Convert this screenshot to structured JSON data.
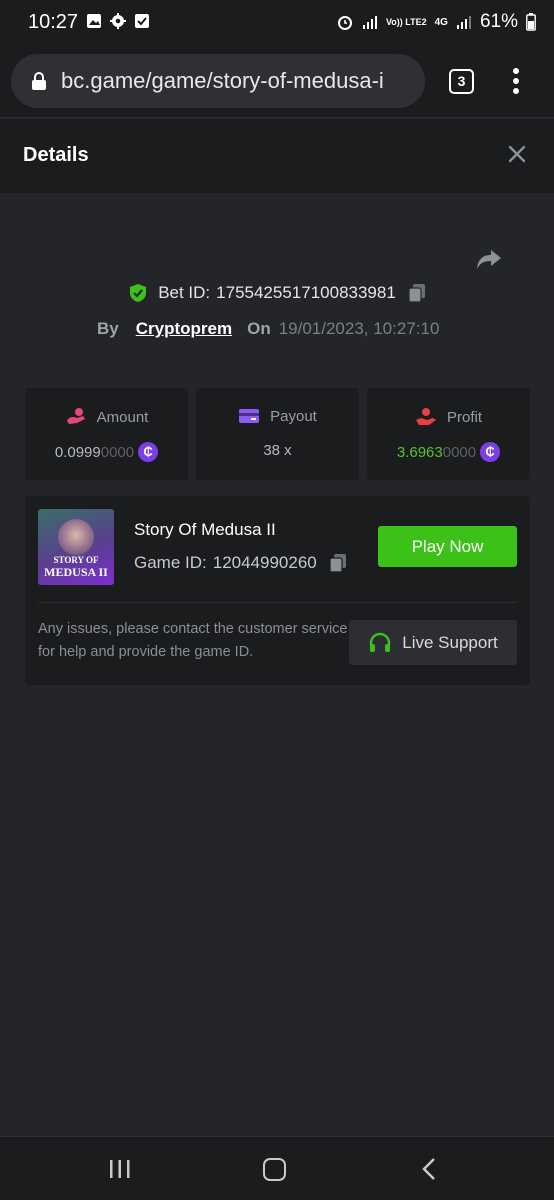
{
  "statusbar": {
    "time": "10:27",
    "network": "Vo)) LTE2",
    "net4g": "4G",
    "battery": "61%"
  },
  "browser": {
    "url": "bc.game/game/story-of-medusa-i",
    "tab_count": "3"
  },
  "header": {
    "title": "Details"
  },
  "bet": {
    "bet_id_label": "Bet ID:",
    "bet_id": "1755425517100833981",
    "by_label": "By",
    "user": "Cryptoprem",
    "on_label": "On",
    "datetime": "19/01/2023, 10:27:10"
  },
  "stats": {
    "amount": {
      "label": "Amount",
      "value_main": "0.0999",
      "value_dim": "0000"
    },
    "payout": {
      "label": "Payout",
      "value": "38 x"
    },
    "profit": {
      "label": "Profit",
      "value_main": "3.6963",
      "value_dim": "0000"
    }
  },
  "coin_symbol": "₵",
  "game": {
    "thumb_line1": "STORY OF",
    "thumb_line2": "MEDUSA II",
    "name": "Story Of Medusa II",
    "game_id_label": "Game ID:",
    "game_id": "12044990260",
    "play_label": "Play Now",
    "support_text": "Any issues, please contact the customer service for help and provide the game ID.",
    "support_label": "Live Support"
  },
  "colors": {
    "accent_green": "#3bc117",
    "coin_purple": "#7c3ee8",
    "amount_icon": "#e8457c",
    "payout_icon": "#8c5cf0",
    "profit_icon": "#e8403c"
  }
}
